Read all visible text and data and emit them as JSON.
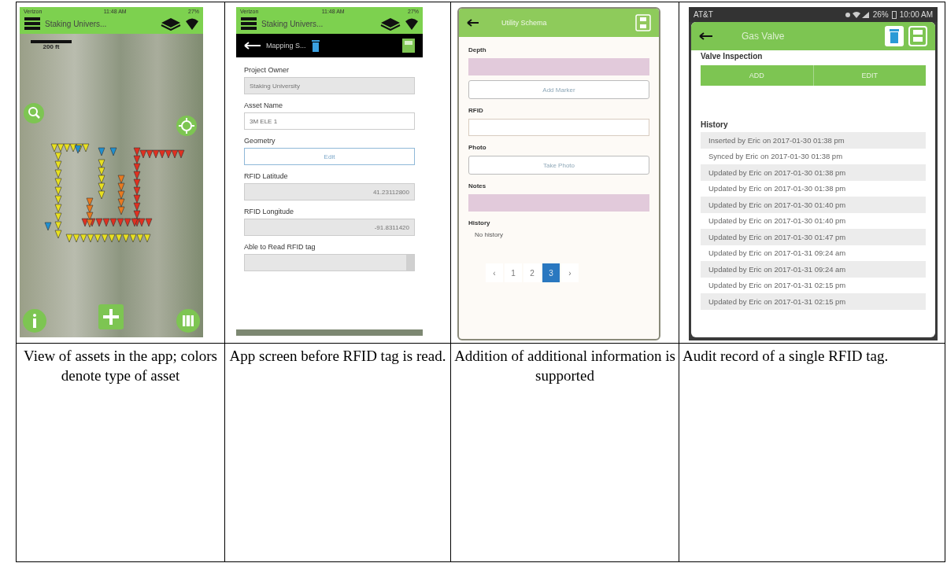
{
  "panels": [
    {
      "kind": "map",
      "status": {
        "carrier": "Verizon",
        "time": "11:48 AM",
        "battery": "27%"
      },
      "title": "Staking Univers...",
      "scale": "200 ft",
      "caption": "View of assets in the app; colors denote type of asset"
    },
    {
      "kind": "form",
      "status": {
        "carrier": "Verizon",
        "time": "11:48 AM",
        "battery": "27%"
      },
      "title": "Staking Univers...",
      "subtitle": "Mapping S...",
      "items": [
        {
          "kind": "label",
          "text": "Project Owner"
        },
        {
          "kind": "input",
          "value": "Staking University",
          "disabled": true
        },
        {
          "kind": "label",
          "text": "Asset Name"
        },
        {
          "kind": "input",
          "value": "3M ELE 1",
          "disabled": false
        },
        {
          "kind": "label",
          "text": "Geometry"
        },
        {
          "kind": "button",
          "label": "Edit"
        },
        {
          "kind": "label",
          "text": "RFID Latitude"
        },
        {
          "kind": "numeric",
          "value": "41.23112800",
          "disabled": true
        },
        {
          "kind": "label",
          "text": "RFID Longitude"
        },
        {
          "kind": "numeric",
          "value": "-91.8311420",
          "disabled": true
        },
        {
          "kind": "label",
          "text": "Able to Read RFID tag"
        },
        {
          "kind": "select"
        }
      ],
      "caption": "App screen before RFID tag is read."
    },
    {
      "kind": "schema",
      "title": "Utility Schema",
      "items": [
        {
          "kind": "label",
          "text": "Depth"
        },
        {
          "kind": "input",
          "tint": true
        },
        {
          "kind": "button",
          "label": "Add Marker"
        },
        {
          "kind": "label",
          "text": "RFID"
        },
        {
          "kind": "input",
          "tint": false
        },
        {
          "kind": "label",
          "text": "Photo"
        },
        {
          "kind": "button",
          "label": "Take Photo"
        },
        {
          "kind": "label",
          "text": "Notes"
        },
        {
          "kind": "input",
          "tint": true
        },
        {
          "kind": "label",
          "text": "History"
        },
        {
          "kind": "note",
          "text": "No history"
        }
      ],
      "pager": {
        "prev": "‹",
        "next": "›",
        "pages": [
          {
            "label": "1",
            "selected": false
          },
          {
            "label": "2",
            "selected": false
          },
          {
            "label": "3",
            "selected": true
          }
        ]
      },
      "caption": "Addition of additional information is supported"
    },
    {
      "kind": "history",
      "status": {
        "carrier": "AT&T",
        "battery": "26%",
        "time": "10:00 AM"
      },
      "title": "Gas Valve",
      "section": "Valve Inspection",
      "buttons": [
        "ADD",
        "EDIT"
      ],
      "history_title": "History",
      "history": [
        "Inserted by Eric on 2017-01-30 01:38 pm",
        "Synced by Eric on 2017-01-30 01:38 pm",
        "Updated by Eric on 2017-01-30 01:38 pm",
        "Updated by Eric on 2017-01-30 01:38 pm",
        "Updated by Eric on 2017-01-30 01:40 pm",
        "Updated by Eric on 2017-01-30 01:40 pm",
        "Updated by Eric on 2017-01-30 01:47 pm",
        "Updated by Eric on 2017-01-31 09:24 am",
        "Updated by Eric on 2017-01-31 09:24 am",
        "Updated by Eric on 2017-01-31 02:15 pm",
        "Updated by Eric on 2017-01-31 02:15 pm"
      ],
      "caption": "Audit record of a single RFID tag."
    }
  ]
}
